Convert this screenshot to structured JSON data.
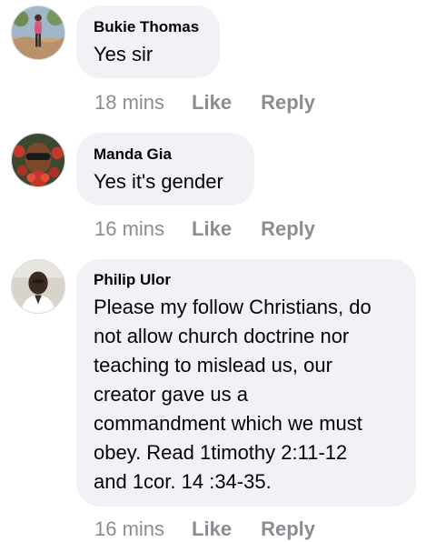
{
  "comments": [
    {
      "author": "Bukie Thomas",
      "text": "Yes sir",
      "time": "18 mins",
      "like_label": "Like",
      "reply_label": "Reply"
    },
    {
      "author": "Manda Gia",
      "text": "Yes it's gender",
      "time": "16 mins",
      "like_label": "Like",
      "reply_label": "Reply"
    },
    {
      "author": "Philip Ulor",
      "text": "Please my follow Christians, do\nnot allow church doctrine  nor\nteaching to mislead us, our\ncreator gave us a\ncommandment which we must\nobey. Read 1timothy 2:11-12\nand 1cor. 14 :34-35.",
      "time": "16 mins",
      "like_label": "Like",
      "reply_label": "Reply"
    }
  ],
  "colors": {
    "bubble": "#f0f2f5",
    "meta_text": "#8a8d91",
    "body_text": "#050505"
  },
  "icons": [
    "avatar-photo",
    "avatar-photo",
    "avatar-photo"
  ]
}
